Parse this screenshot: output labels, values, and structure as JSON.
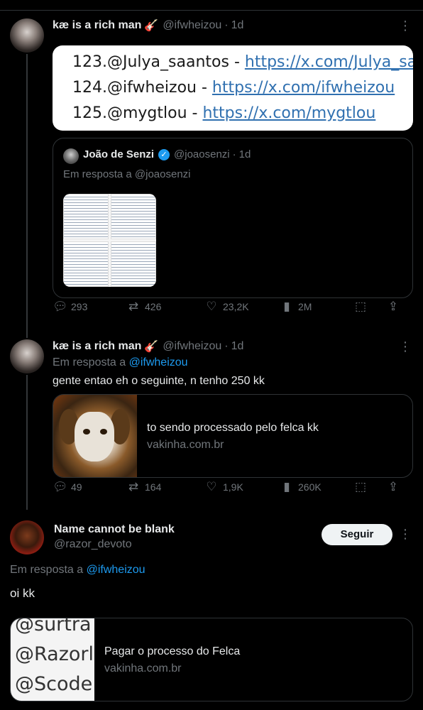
{
  "tweet1": {
    "name": "kæ is a rich man",
    "emoji": "🎸",
    "handle": "@ifwheizou",
    "time": "1d",
    "image_lines": [
      {
        "num": "123.@Julya_saantos - ",
        "link": "https://x.com/Julya_sa"
      },
      {
        "num": "124.@ifwheizou - ",
        "link": "https://x.com/ifwheizou"
      },
      {
        "num": "125.@mygtlou - ",
        "link": "https://x.com/mygtlou"
      }
    ],
    "quote": {
      "name": "João de Senzi",
      "handle": "@joaosenzi",
      "time": "1d",
      "reply_prefix": "Em resposta a ",
      "reply_to": "@joaosenzi"
    },
    "replies": "293",
    "reposts": "426",
    "likes": "23,2K",
    "views": "2M"
  },
  "tweet2": {
    "name": "kæ is a rich man",
    "emoji": "🎸",
    "handle": "@ifwheizou",
    "time": "1d",
    "reply_prefix": "Em resposta a ",
    "reply_to": "@ifwheizou",
    "text": "gente entao eh o seguinte, n tenho 250 kk",
    "card_title": "to sendo processado pelo felca kk",
    "card_domain": "vakinha.com.br",
    "replies": "49",
    "reposts": "164",
    "likes": "1,9K",
    "views": "260K"
  },
  "tweet3": {
    "name": "Name cannot be blank",
    "handle": "@razor_devoto",
    "follow_label": "Seguir",
    "reply_prefix": "Em resposta a ",
    "reply_to": "@ifwheizou",
    "text": "oi kk",
    "thumb_lines": [
      "@surtra",
      "@Razorl",
      "@Scode"
    ],
    "card_title": "Pagar o processo do Felca",
    "card_domain": "vakinha.com.br"
  },
  "icons": {
    "reply": "reply-icon",
    "repost": "repost-icon",
    "like": "like-icon",
    "views": "views-icon",
    "bookmark": "bookmark-icon",
    "share": "share-icon",
    "more": "more-icon"
  }
}
